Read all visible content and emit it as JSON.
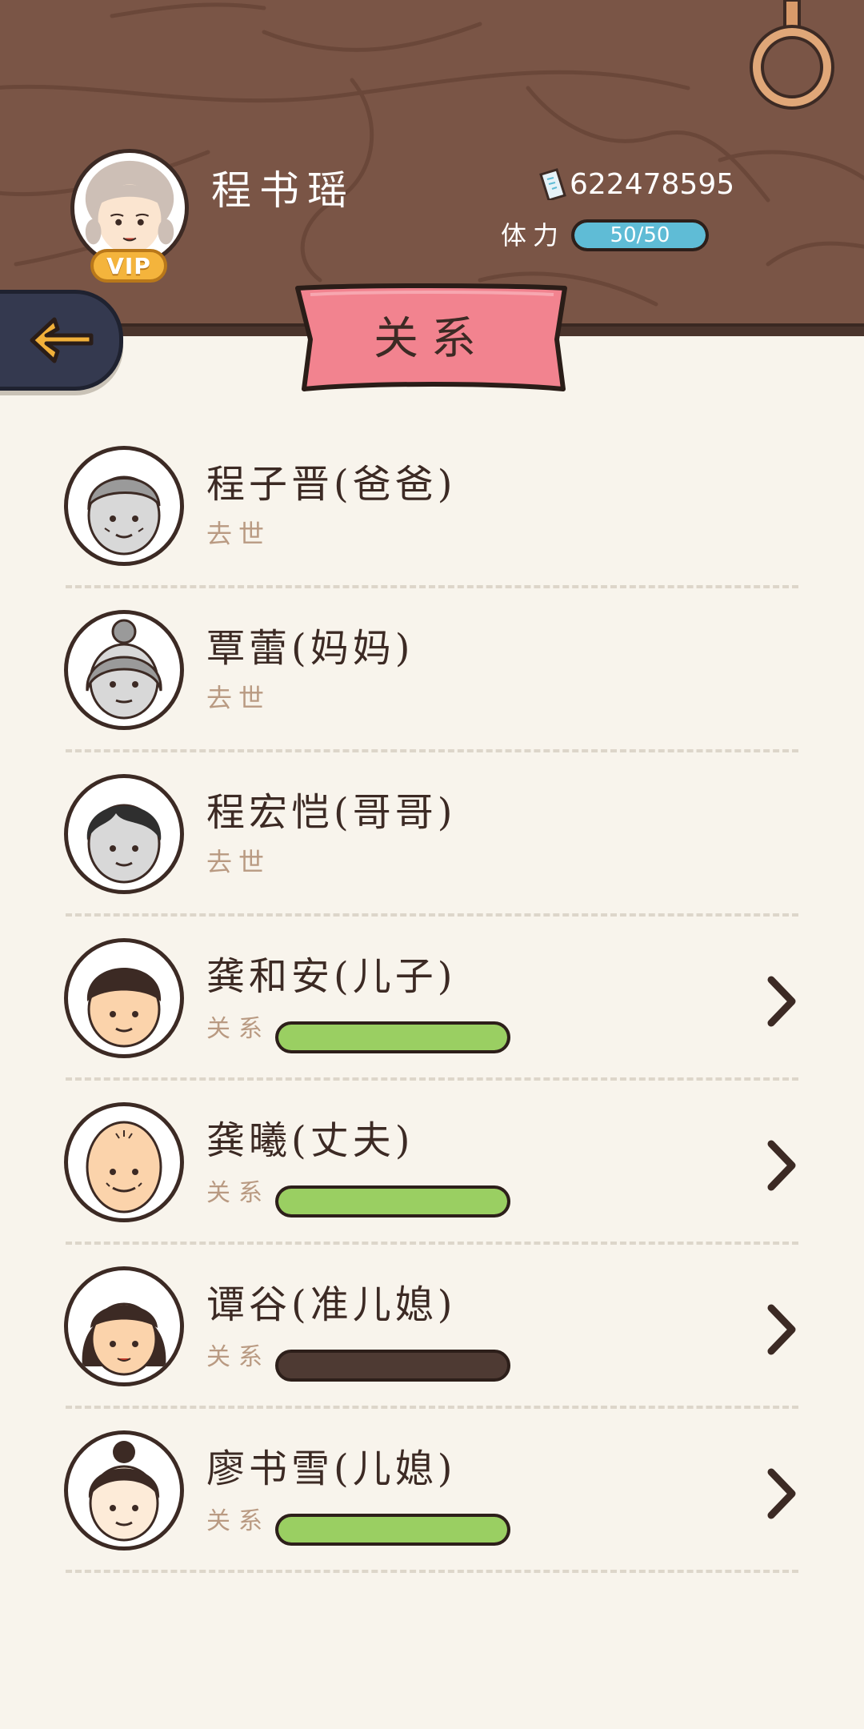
{
  "player": {
    "name": "程书瑶",
    "vip_label": "VIP",
    "currency": "622478595",
    "stamina_label": "体力",
    "stamina_text": "50/50",
    "stamina_fraction": 1.0
  },
  "page": {
    "title": "关系"
  },
  "icons": {
    "back": "arrow-left-icon",
    "currency": "coin-ticket-icon",
    "row_action": "chevron-right-icon",
    "ring": "hanging-ring-icon"
  },
  "colors": {
    "wood": "#7a5546",
    "ribbon": "#f2838f",
    "stamina": "#5fbcd6",
    "relation_good": "#9acf62",
    "relation_empty": "#4e3a33",
    "text_dark": "#3c2a24",
    "text_muted": "#b99a82"
  },
  "relations": [
    {
      "name": "程子晋(爸爸)",
      "status": "去世",
      "deceased": true,
      "avatar": "gray-old-man"
    },
    {
      "name": "覃蕾(妈妈)",
      "status": "去世",
      "deceased": true,
      "avatar": "gray-old-woman"
    },
    {
      "name": "程宏恺(哥哥)",
      "status": "去世",
      "deceased": true,
      "avatar": "gray-young-man"
    },
    {
      "name": "龚和安(儿子)",
      "rel_label": "关系",
      "level": 1.0,
      "deceased": false,
      "avatar": "young-man"
    },
    {
      "name": "龚曦(丈夫)",
      "rel_label": "关系",
      "level": 1.0,
      "deceased": false,
      "avatar": "bald-old-man"
    },
    {
      "name": "谭谷(准儿媳)",
      "rel_label": "关系",
      "level": 0.0,
      "deceased": false,
      "avatar": "young-woman-bob"
    },
    {
      "name": "廖书雪(儿媳)",
      "rel_label": "关系",
      "level": 1.0,
      "deceased": false,
      "avatar": "young-woman-bun"
    }
  ]
}
